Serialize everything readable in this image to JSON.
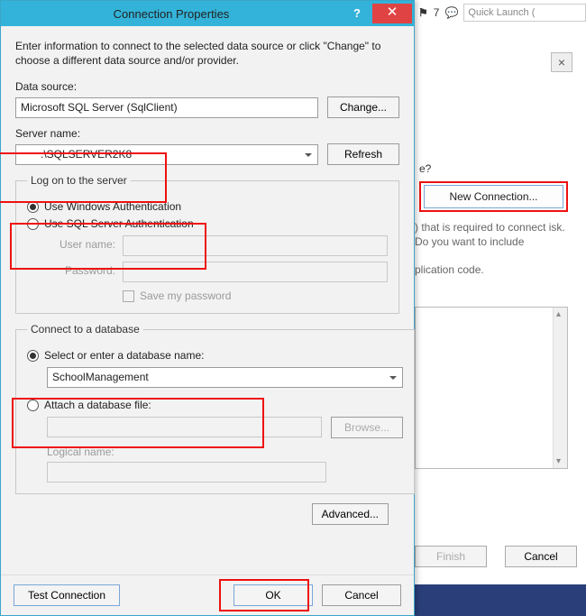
{
  "title": "Connection Properties",
  "intro": "Enter information to connect to the selected data source or click \"Change\" to choose a different data source and/or provider.",
  "dataSource": {
    "label": "Data source:",
    "value": "Microsoft SQL Server (SqlClient)",
    "changeBtn": "Change..."
  },
  "serverName": {
    "label": "Server name:",
    "value": ".\\SQLSERVER2K8",
    "refreshBtn": "Refresh"
  },
  "logon": {
    "legend": "Log on to the server",
    "winAuth": "Use Windows Authentication",
    "sqlAuth": "Use SQL Server Authentication",
    "selected": "winAuth",
    "userLabel": "User name:",
    "passLabel": "Password:",
    "savePass": "Save my password"
  },
  "connectDb": {
    "legend": "Connect to a database",
    "selectRadio": "Select or enter a database name:",
    "attachRadio": "Attach a database file:",
    "selected": "select",
    "dbName": "SchoolManagement",
    "browseBtn": "Browse...",
    "logicalLabel": "Logical name:"
  },
  "advancedBtn": "Advanced...",
  "footer": {
    "test": "Test Connection",
    "ok": "OK",
    "cancel": "Cancel"
  },
  "bg": {
    "flag7": "7",
    "quickLaunch": "Quick Launch (",
    "questionTail": "e?",
    "newConnection": "New Connection...",
    "desc1": ") that is required to connect isk. Do you want to include",
    "desc2": "plication code.",
    "finish": "Finish",
    "cancel": "Cancel"
  }
}
